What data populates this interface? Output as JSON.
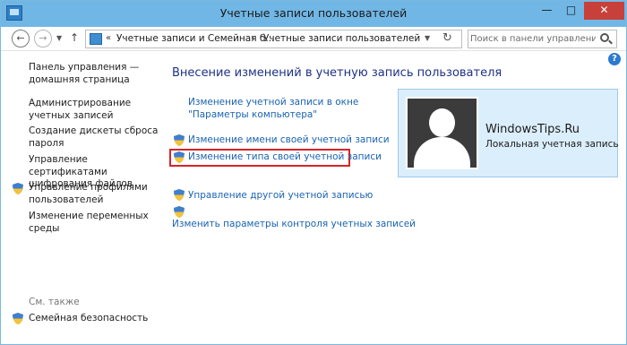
{
  "window": {
    "title": "Учетные записи пользователей",
    "buttons": {
      "minimize": "—",
      "maximize": "□",
      "close": "✕"
    }
  },
  "navigation": {
    "back_icon": "arrow-left",
    "forward_icon": "arrow-right",
    "up_icon": "arrow-up",
    "breadcrumb": [
      "Учетные записи и Семейная б...",
      "Учетные записи пользователей"
    ],
    "breadcrumb_sep": "«",
    "search_placeholder": "Поиск в панели управления"
  },
  "sidebar": {
    "home": "Панель управления — домашняя страница",
    "items": [
      {
        "label": "Администрирование учетных записей",
        "shield": false
      },
      {
        "label": "Создание дискеты сброса пароля",
        "shield": false
      },
      {
        "label": "Управление сертификатами шифрования файлов",
        "shield": false
      },
      {
        "label": "Управление профилями пользователей",
        "shield": true
      },
      {
        "label": "Изменение переменных среды",
        "shield": false
      }
    ],
    "see_also_label": "См. также",
    "see_also_items": [
      {
        "label": "Семейная безопасность",
        "shield": true
      }
    ]
  },
  "main": {
    "heading": "Внесение изменений в учетную запись пользователя",
    "links": [
      {
        "label": "Изменение учетной записи в окне \"Параметры компьютера\"",
        "shield": false
      },
      {
        "label": "Изменение имени своей учетной записи",
        "shield": true
      },
      {
        "label": "Изменение типа своей учетной записи",
        "shield": true,
        "highlighted": true
      },
      {
        "label": "Управление другой учетной записью",
        "shield": true
      },
      {
        "label": "Изменить параметры контроля учетных записей",
        "shield": true
      }
    ]
  },
  "account": {
    "name": "WindowsTips.Ru",
    "type": "Локальная учетная запись"
  },
  "colors": {
    "titlebar": "#71b7e6",
    "link": "#1a63b0",
    "heading": "#1e3287",
    "highlight_border": "#d8232a",
    "card_bg": "#dbeefb"
  }
}
